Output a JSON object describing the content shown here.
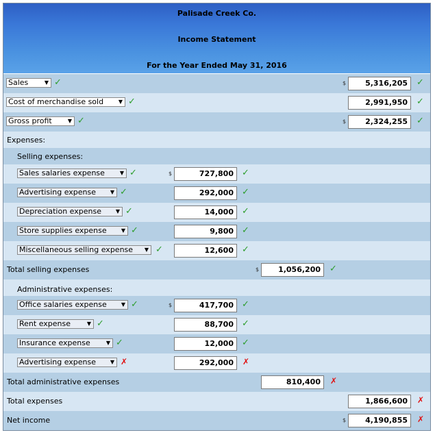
{
  "header": {
    "company": "Palisade Creek Co.",
    "statement": "Income Statement",
    "period": "For the Year Ended May 31, 2016"
  },
  "currency": "$",
  "rows": {
    "sales": {
      "label": "Sales",
      "value": "5,316,205"
    },
    "cogs": {
      "label": "Cost of merchandise sold",
      "value": "2,991,950"
    },
    "gross": {
      "label": "Gross profit",
      "value": "2,324,255"
    },
    "expenses": {
      "label": "Expenses:"
    },
    "selling": {
      "label": "Selling expenses:"
    },
    "sales_salaries": {
      "label": "Sales salaries expense",
      "value": "727,800"
    },
    "advertising": {
      "label": "Advertising expense",
      "value": "292,000"
    },
    "depreciation": {
      "label": "Depreciation expense",
      "value": "14,000"
    },
    "store_supplies": {
      "label": "Store supplies expense",
      "value": "9,800"
    },
    "misc_selling": {
      "label": "Miscellaneous selling expense",
      "value": "12,600"
    },
    "total_selling": {
      "label": "Total selling expenses",
      "value": "1,056,200"
    },
    "admin": {
      "label": "Administrative expenses:"
    },
    "office_salaries": {
      "label": "Office salaries expense",
      "value": "417,700"
    },
    "rent": {
      "label": "Rent expense",
      "value": "88,700"
    },
    "insurance": {
      "label": "Insurance expense",
      "value": "12,000"
    },
    "advertising2": {
      "label": "Advertising expense",
      "value": "292,000"
    },
    "total_admin": {
      "label": "Total administrative expenses",
      "value": "810,400"
    },
    "total_expenses": {
      "label": "Total expenses",
      "value": "1,866,600"
    },
    "net_income": {
      "label": "Net income",
      "value": "4,190,855"
    }
  },
  "marks": {
    "correct": "✓",
    "incorrect": "✗"
  },
  "colors": {
    "correct": "#2e9e2e",
    "incorrect": "#e01010",
    "header": "#3a78d8"
  }
}
